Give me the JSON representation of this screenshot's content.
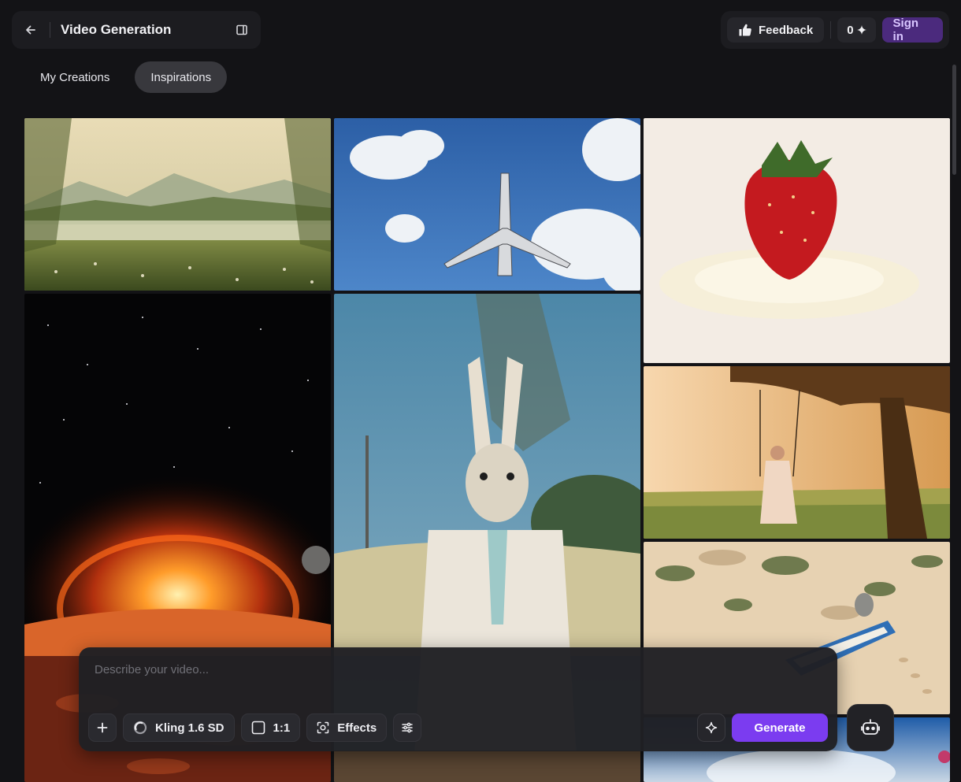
{
  "header": {
    "back_icon": "arrow-left-icon",
    "title": "Video Generation",
    "panel_icon": "sidebar-toggle-icon",
    "feedback_label": "Feedback",
    "feedback_icon": "thumbs-up-icon",
    "credits_value": "0",
    "credits_icon": "sparkle-icon",
    "signin_label": "Sign in"
  },
  "tabs": [
    {
      "label": "My Creations",
      "active": false
    },
    {
      "label": "Inspirations",
      "active": true
    }
  ],
  "gallery": {
    "items": [
      {
        "subject": "lake-landscape"
      },
      {
        "subject": "airplane-sky"
      },
      {
        "subject": "strawberry-cream"
      },
      {
        "subject": "solar-eruption"
      },
      {
        "subject": "rabbit-in-suit"
      },
      {
        "subject": "girl-on-swing"
      },
      {
        "subject": "alien-in-boat"
      },
      {
        "subject": "sky-partial"
      }
    ]
  },
  "prompt": {
    "placeholder": "Describe your video...",
    "value": "",
    "add_icon": "plus-icon",
    "model_label": "Kling 1.6 SD",
    "model_icon": "model-logo-icon",
    "ratio_label": "1:1",
    "ratio_icon": "square-ratio-icon",
    "effects_label": "Effects",
    "effects_icon": "effects-scan-icon",
    "settings_icon": "sliders-icon",
    "enhance_icon": "sparkle-enhance-icon",
    "generate_label": "Generate"
  },
  "assistant": {
    "icon": "robot-icon"
  },
  "colors": {
    "background": "#131316",
    "accent": "#7b3cf0",
    "signin_bg": "#4b2a7d"
  }
}
